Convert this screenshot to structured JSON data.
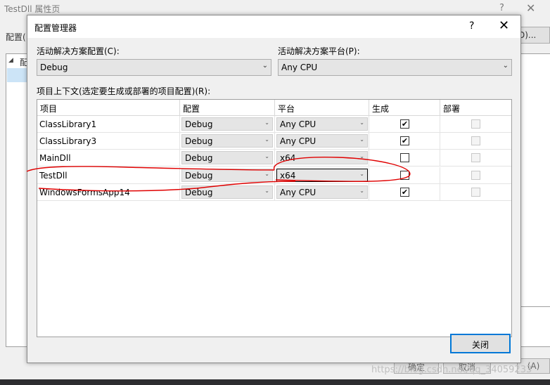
{
  "background_window": {
    "title": "TestDll 属性页",
    "help": "?",
    "close": "✕",
    "config_label": "配置(",
    "config_manager_button": "D)...",
    "tree_toggle": "◢",
    "tree_item": "配",
    "ok_button": "确定",
    "cancel_button": "取消",
    "apply_button": "(A)"
  },
  "dialog": {
    "title": "配置管理器",
    "help": "?",
    "close": "✕",
    "active_config_label": "活动解决方案配置(C):",
    "active_config_value": "Debug",
    "active_platform_label": "活动解决方案平台(P):",
    "active_platform_value": "Any CPU",
    "contexts_label": "项目上下文(选定要生成或部署的项目配置)(R):",
    "columns": [
      "项目",
      "配置",
      "平台",
      "生成",
      "部署"
    ],
    "rows": [
      {
        "project": "ClassLibrary1",
        "config": "Debug",
        "platform": "Any CPU",
        "build": true,
        "deploy": false
      },
      {
        "project": "ClassLibrary3",
        "config": "Debug",
        "platform": "Any CPU",
        "build": true,
        "deploy": false
      },
      {
        "project": "MainDll",
        "config": "Debug",
        "platform": "x64",
        "build": false,
        "deploy": false
      },
      {
        "project": "TestDll",
        "config": "Debug",
        "platform": "x64",
        "build": false,
        "deploy": false
      },
      {
        "project": "WindowsFormsApp14",
        "config": "Debug",
        "platform": "Any CPU",
        "build": true,
        "deploy": false
      }
    ],
    "close_button": "关闭",
    "check_glyph": "✔",
    "dropdown_glyph": "⌄"
  },
  "watermark": "https://blog.csdn.net/qq_34059233",
  "colors": {
    "accent": "#0078d7",
    "annotation": "#e00000"
  }
}
